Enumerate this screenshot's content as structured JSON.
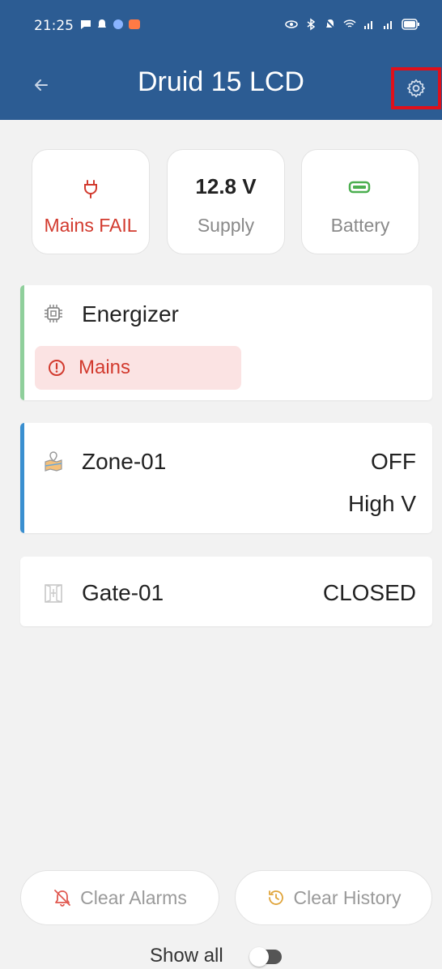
{
  "status_bar": {
    "time": "21:25"
  },
  "app_bar": {
    "title": "Druid 15 LCD",
    "back_icon": "arrow-left-icon",
    "settings_icon": "gear-icon"
  },
  "summary_tiles": [
    {
      "icon": "plug-icon",
      "label": "Mains FAIL",
      "color": "#d23a2e"
    },
    {
      "value": "12.8 V",
      "label": "Supply"
    },
    {
      "icon": "battery-icon",
      "label": "Battery",
      "color": "#4caf50"
    }
  ],
  "energizer": {
    "name": "Energizer",
    "icon": "chip-icon",
    "accent": "#8fcf9b",
    "alert": {
      "icon": "alert-circle-icon",
      "label": "Mains"
    }
  },
  "zone": {
    "name": "Zone-01",
    "icon": "map-icon",
    "accent": "#3a8fd0",
    "state": "OFF",
    "voltage": "High V"
  },
  "gate": {
    "name": "Gate-01",
    "icon": "gate-icon",
    "state": "CLOSED"
  },
  "actions": {
    "clear_alarms": "Clear Alarms",
    "clear_history": "Clear History"
  },
  "footer": {
    "show_all": "Show all",
    "toggle_on": false
  }
}
